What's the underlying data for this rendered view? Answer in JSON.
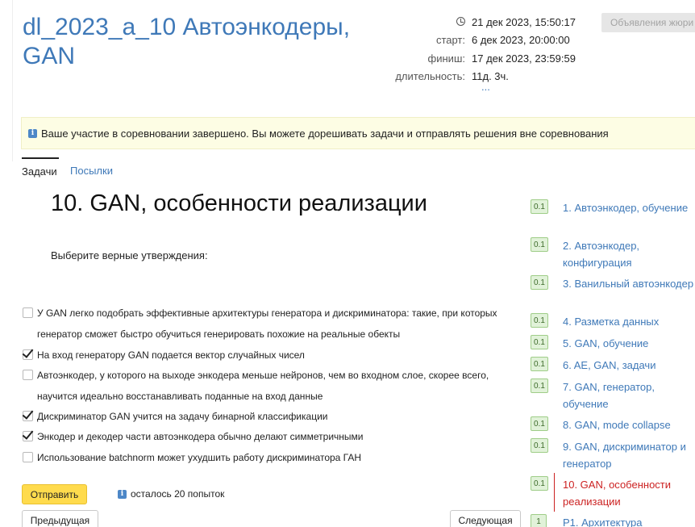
{
  "header": {
    "title": "dl_2023_a_10 Автоэнкодеры, GAN",
    "current_time": "21 дек 2023, 15:50:17",
    "start_label": "старт:",
    "start_value": "6 дек 2023, 20:00:00",
    "finish_label": "финиш:",
    "finish_value": "17 дек 2023, 23:59:59",
    "duration_label": "длительность:",
    "duration_value": "11д. 3ч.",
    "more_link": "...",
    "jury_button": "Объявления жюри"
  },
  "notice": {
    "text": "Ваше участие в соревновании завершено. Вы можете дорешивать задачи и отправлять решения вне соревнования"
  },
  "tabs": {
    "tasks": "Задачи",
    "submissions": "Посылки"
  },
  "task": {
    "title": "10. GAN, особенности реализации",
    "prompt": "Выберите верные утверждения:",
    "options": [
      {
        "text": "У GAN легко подобрать эффективные архитектуры генератора и дискриминатора: такие, при которых генератор сможет быстро обучиться генерировать похожие на реальные обекты",
        "checked": false
      },
      {
        "text": "На вход генератору GAN подается вектор случайных чисел",
        "checked": true
      },
      {
        "text": "Автоэнкодер, у которого на выходе энкодера меньше нейронов, чем во входном слое, скорее всего, научится идеально восстанавливать поданные на вход данные",
        "checked": false
      },
      {
        "text": "Дискриминатор GAN учится на задачу бинарной классификации",
        "checked": true
      },
      {
        "text": "Энкодер и декодер части автоэнкодера обычно делают симметричными",
        "checked": true
      },
      {
        "text": "Использование batchnorm может ухудшить работу дискриминатора ГАН",
        "checked": false
      }
    ],
    "submit_label": "Отправить",
    "attempts_text": "осталось 20 попыток",
    "prev_label": "Предыдущая",
    "next_label": "Следующая"
  },
  "sidebar": {
    "items": [
      {
        "badge": "0.1",
        "label": "1. Автоэнкодер, обучение"
      },
      {
        "badge": "0.1",
        "label": "2. Автоэнкодер, конфигурация"
      },
      {
        "badge": "0.1",
        "label": "3. Ванильный автоэнкодер"
      },
      {
        "badge": "0.1",
        "label": "4. Разметка данных"
      },
      {
        "badge": "0.1",
        "label": "5. GAN, обучение"
      },
      {
        "badge": "0.1",
        "label": "6. AE, GAN, задачи"
      },
      {
        "badge": "0.1",
        "label": "7. GAN, генератор, обучение"
      },
      {
        "badge": "0.1",
        "label": "8. GAN, mode collapse"
      },
      {
        "badge": "0.1",
        "label": "9. GAN, дискриминатор и генератор"
      },
      {
        "badge": "0.1",
        "label": "10. GAN, особенности реализации"
      },
      {
        "badge": "1",
        "label": "P1. Архитектура"
      }
    ]
  },
  "colors": {
    "link": "#3f79b8",
    "active": "#cc2222",
    "submit": "#ffdb4d",
    "badge_bg": "#e1f2d9"
  }
}
